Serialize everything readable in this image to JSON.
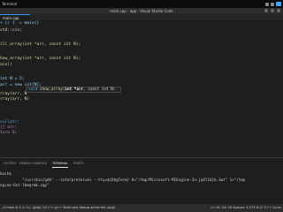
{
  "os_bar": {
    "activities_label": "Terminal"
  },
  "window": {
    "title": "main.cpp - app - Visual Studio Code"
  },
  "tabs": [
    {
      "label": "main.cpp"
    }
  ],
  "editor": {
    "lines": [
      {
        "text": "+ () {  ◇ main()"
      },
      {
        "text": "std::cin;"
      },
      {
        "text": ""
      },
      {
        "text": "ill_array(int *arr, const int N);"
      },
      {
        "text": ""
      },
      {
        "text": "how_array(int *arr, const int N);"
      },
      {
        "text": "ain()"
      },
      {
        "text": ""
      },
      {
        "text": "int N = 5;"
      },
      {
        "text": "arr = new int[N];"
      },
      {
        "text": ""
      },
      {
        "text": "rray(arr, N"
      },
      {
        "text": "rray(arr, N)"
      },
      {
        "text": ""
      },
      {
        "text": ""
      },
      {
        "text": ""
      },
      {
        "text": "nullptr;"
      },
      {
        "text": "[] arr;"
      },
      {
        "text": "turn 0;"
      }
    ],
    "tooltip": {
      "return_type": "void",
      "function_name": "show_array",
      "params_before": "(",
      "param_highlight": "int *arr",
      "params_after": ", const int N)"
    }
  },
  "panel": {
    "tabs": [
      {
        "label": "OUTPUT"
      },
      {
        "label": "DEBUG CONSOLE"
      },
      {
        "label": "TERMINAL"
      },
      {
        "label": "PORTS"
      }
    ],
    "terminal_lines": [
      {
        "text": "bash$"
      },
      {
        "text": "          \"/usr/bin/gdb\" --interpreter=mi --tty=${DbgTerm} 0<\"/tmp/Microsoft-MIEngine-In-jq4l1djb.3wt\" 1>\"/tmp"
      },
      {
        "text": "ngine-Out-lbmqrmk.zqp\""
      },
      {
        "text": ""
      },
      {
        "text": ""
      }
    ]
  },
  "status_bar": {
    "left": "⎇ main  ⊗ 0 ⚠ 0  ▷ (gdb) C/C++: g++ Build and debug active file (app)",
    "right": "Ln 16, Col 18   Spaces: 4   UTF-8   LF   C++   Linux"
  }
}
